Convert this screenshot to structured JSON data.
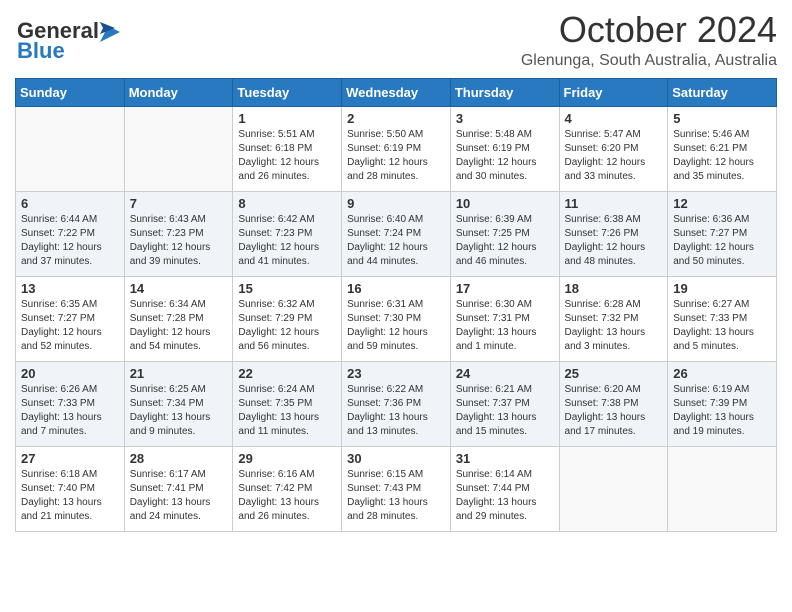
{
  "header": {
    "logo_line1": "General",
    "logo_line2": "Blue",
    "month": "October 2024",
    "location": "Glenunga, South Australia, Australia"
  },
  "days_of_week": [
    "Sunday",
    "Monday",
    "Tuesday",
    "Wednesday",
    "Thursday",
    "Friday",
    "Saturday"
  ],
  "weeks": [
    [
      {
        "day": "",
        "info": ""
      },
      {
        "day": "",
        "info": ""
      },
      {
        "day": "1",
        "info": "Sunrise: 5:51 AM\nSunset: 6:18 PM\nDaylight: 12 hours\nand 26 minutes."
      },
      {
        "day": "2",
        "info": "Sunrise: 5:50 AM\nSunset: 6:19 PM\nDaylight: 12 hours\nand 28 minutes."
      },
      {
        "day": "3",
        "info": "Sunrise: 5:48 AM\nSunset: 6:19 PM\nDaylight: 12 hours\nand 30 minutes."
      },
      {
        "day": "4",
        "info": "Sunrise: 5:47 AM\nSunset: 6:20 PM\nDaylight: 12 hours\nand 33 minutes."
      },
      {
        "day": "5",
        "info": "Sunrise: 5:46 AM\nSunset: 6:21 PM\nDaylight: 12 hours\nand 35 minutes."
      }
    ],
    [
      {
        "day": "6",
        "info": "Sunrise: 6:44 AM\nSunset: 7:22 PM\nDaylight: 12 hours\nand 37 minutes."
      },
      {
        "day": "7",
        "info": "Sunrise: 6:43 AM\nSunset: 7:23 PM\nDaylight: 12 hours\nand 39 minutes."
      },
      {
        "day": "8",
        "info": "Sunrise: 6:42 AM\nSunset: 7:23 PM\nDaylight: 12 hours\nand 41 minutes."
      },
      {
        "day": "9",
        "info": "Sunrise: 6:40 AM\nSunset: 7:24 PM\nDaylight: 12 hours\nand 44 minutes."
      },
      {
        "day": "10",
        "info": "Sunrise: 6:39 AM\nSunset: 7:25 PM\nDaylight: 12 hours\nand 46 minutes."
      },
      {
        "day": "11",
        "info": "Sunrise: 6:38 AM\nSunset: 7:26 PM\nDaylight: 12 hours\nand 48 minutes."
      },
      {
        "day": "12",
        "info": "Sunrise: 6:36 AM\nSunset: 7:27 PM\nDaylight: 12 hours\nand 50 minutes."
      }
    ],
    [
      {
        "day": "13",
        "info": "Sunrise: 6:35 AM\nSunset: 7:27 PM\nDaylight: 12 hours\nand 52 minutes."
      },
      {
        "day": "14",
        "info": "Sunrise: 6:34 AM\nSunset: 7:28 PM\nDaylight: 12 hours\nand 54 minutes."
      },
      {
        "day": "15",
        "info": "Sunrise: 6:32 AM\nSunset: 7:29 PM\nDaylight: 12 hours\nand 56 minutes."
      },
      {
        "day": "16",
        "info": "Sunrise: 6:31 AM\nSunset: 7:30 PM\nDaylight: 12 hours\nand 59 minutes."
      },
      {
        "day": "17",
        "info": "Sunrise: 6:30 AM\nSunset: 7:31 PM\nDaylight: 13 hours\nand 1 minute."
      },
      {
        "day": "18",
        "info": "Sunrise: 6:28 AM\nSunset: 7:32 PM\nDaylight: 13 hours\nand 3 minutes."
      },
      {
        "day": "19",
        "info": "Sunrise: 6:27 AM\nSunset: 7:33 PM\nDaylight: 13 hours\nand 5 minutes."
      }
    ],
    [
      {
        "day": "20",
        "info": "Sunrise: 6:26 AM\nSunset: 7:33 PM\nDaylight: 13 hours\nand 7 minutes."
      },
      {
        "day": "21",
        "info": "Sunrise: 6:25 AM\nSunset: 7:34 PM\nDaylight: 13 hours\nand 9 minutes."
      },
      {
        "day": "22",
        "info": "Sunrise: 6:24 AM\nSunset: 7:35 PM\nDaylight: 13 hours\nand 11 minutes."
      },
      {
        "day": "23",
        "info": "Sunrise: 6:22 AM\nSunset: 7:36 PM\nDaylight: 13 hours\nand 13 minutes."
      },
      {
        "day": "24",
        "info": "Sunrise: 6:21 AM\nSunset: 7:37 PM\nDaylight: 13 hours\nand 15 minutes."
      },
      {
        "day": "25",
        "info": "Sunrise: 6:20 AM\nSunset: 7:38 PM\nDaylight: 13 hours\nand 17 minutes."
      },
      {
        "day": "26",
        "info": "Sunrise: 6:19 AM\nSunset: 7:39 PM\nDaylight: 13 hours\nand 19 minutes."
      }
    ],
    [
      {
        "day": "27",
        "info": "Sunrise: 6:18 AM\nSunset: 7:40 PM\nDaylight: 13 hours\nand 21 minutes."
      },
      {
        "day": "28",
        "info": "Sunrise: 6:17 AM\nSunset: 7:41 PM\nDaylight: 13 hours\nand 24 minutes."
      },
      {
        "day": "29",
        "info": "Sunrise: 6:16 AM\nSunset: 7:42 PM\nDaylight: 13 hours\nand 26 minutes."
      },
      {
        "day": "30",
        "info": "Sunrise: 6:15 AM\nSunset: 7:43 PM\nDaylight: 13 hours\nand 28 minutes."
      },
      {
        "day": "31",
        "info": "Sunrise: 6:14 AM\nSunset: 7:44 PM\nDaylight: 13 hours\nand 29 minutes."
      },
      {
        "day": "",
        "info": ""
      },
      {
        "day": "",
        "info": ""
      }
    ]
  ]
}
